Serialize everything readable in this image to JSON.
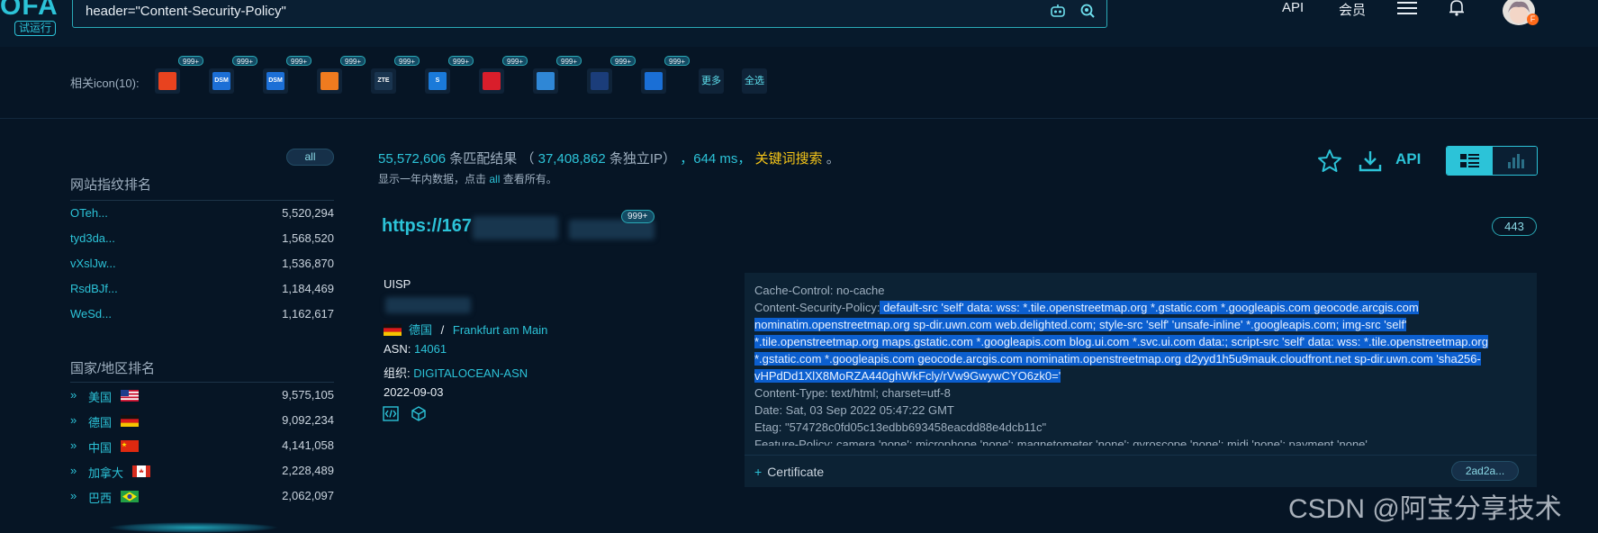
{
  "header": {
    "logo": "OFA",
    "trial_badge": "试运行",
    "search_query": "header=\"Content-Security-Policy\"",
    "api_label": "API",
    "member_label": "会员",
    "avatar_badge": "F"
  },
  "related_icons": {
    "label": "相关icon(10):",
    "badge": "999+",
    "items": [
      {
        "icon": "spider-icon",
        "color": "#e8431f",
        "text": ""
      },
      {
        "icon": "dsm-icon",
        "color": "#1c6fd6",
        "text": "DSM"
      },
      {
        "icon": "dsm-icon",
        "color": "#1c6fd6",
        "text": "DSM"
      },
      {
        "icon": "swoosh-icon",
        "color": "#f07b1f",
        "text": ""
      },
      {
        "icon": "zte-icon",
        "color": "#1a3550",
        "text": "ZTE"
      },
      {
        "icon": "s-logo-icon",
        "color": "#1a7ad9",
        "text": "S"
      },
      {
        "icon": "red-dots-icon",
        "color": "#d91e2b",
        "text": ""
      },
      {
        "icon": "feather-icon",
        "color": "#2f87d6",
        "text": ""
      },
      {
        "icon": "triple-ring-icon",
        "color": "#1b3d7a",
        "text": ""
      },
      {
        "icon": "chevron-right-icon",
        "color": "#1a6fd6",
        "text": ""
      }
    ],
    "more_label": "更多",
    "select_all_label": "全选"
  },
  "sidebar": {
    "all_pill": "all",
    "site_rank_title": "网站指纹排名",
    "sites": [
      {
        "name": "OTeh...",
        "count": "5,520,294"
      },
      {
        "name": "tyd3da...",
        "count": "1,568,520"
      },
      {
        "name": "vXslJw...",
        "count": "1,536,870"
      },
      {
        "name": "RsdBJf...",
        "count": "1,184,469"
      },
      {
        "name": "WeSd...",
        "count": "1,162,617"
      }
    ],
    "country_rank_title": "国家/地区排名",
    "countries": [
      {
        "name": "美国",
        "count": "9,575,105",
        "flag": "us"
      },
      {
        "name": "德国",
        "count": "9,092,234",
        "flag": "de"
      },
      {
        "name": "中国",
        "count": "4,141,058",
        "flag": "cn"
      },
      {
        "name": "加拿大",
        "count": "2,228,489",
        "flag": "ca"
      },
      {
        "name": "巴西",
        "count": "2,062,097",
        "flag": "br"
      }
    ]
  },
  "results": {
    "total": "55,572,606",
    "total_suffix": "条匹配结果",
    "open_paren": "（",
    "ip_count": "37,408,862",
    "ip_suffix": "条独立IP）",
    "time": "，644 ms，",
    "keyword_search": "关键词搜索",
    "period": "。",
    "sub_text_1": "显示一年内数据，点击",
    "sub_link": "all",
    "sub_text_2": "查看所有。",
    "api_label": "API"
  },
  "result_item": {
    "url": "https://167",
    "badge": "999+",
    "port": "443",
    "title": "UISP",
    "country": "德国",
    "separator": "/",
    "city": "Frankfurt am Main",
    "asn_label": "ASN:",
    "asn": "14061",
    "org_label": "组织:",
    "org": "DIGITALOCEAN-ASN",
    "date": "2022-09-03",
    "headers": {
      "cache_control": "Cache-Control: no-cache",
      "csp_label": "Content-Security-Policy:",
      "csp_value": " default-src 'self' data: wss: *.tile.openstreetmap.org *.gstatic.com *.googleapis.com geocode.arcgis.com nominatim.openstreetmap.org sp-dir.uwn.com web.delighted.com; style-src 'self' 'unsafe-inline' *.googleapis.com; img-src 'self' *.tile.openstreetmap.org maps.gstatic.com *.googleapis.com blog.ui.com *.svc.ui.com data:; script-src 'self' data: wss: *.tile.openstreetmap.org *.gstatic.com *.googleapis.com geocode.arcgis.com nominatim.openstreetmap.org d2yyd1h5u9mauk.cloudfront.net sp-dir.uwn.com 'sha256-vHPdDd1XlX8MoRZA440ghWkFcly/rVw9GwywCYO6zk0='",
      "content_type": "Content-Type: text/html; charset=utf-8",
      "date": "Date: Sat, 03 Sep 2022 05:47:22 GMT",
      "etag": "Etag: \"574728c0fd05c13edbb693458eacdd88e4dcb11c\"",
      "feature_policy": "Feature-Policy: camera 'none'; microphone 'none'; magnetometer 'none'; gyroscope 'none'; midi 'none'; payment 'none'"
    },
    "certificate_label": "Certificate",
    "cert_hash": "2ad2a..."
  },
  "watermark": "CSDN @阿宝分享技术"
}
